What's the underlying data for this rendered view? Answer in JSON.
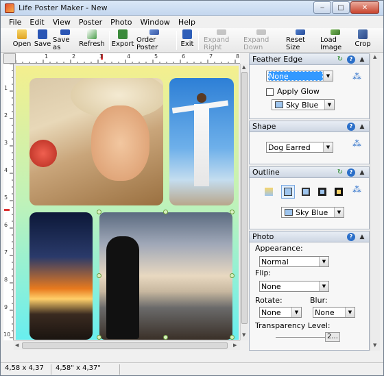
{
  "window": {
    "title": "Life Poster Maker - New"
  },
  "menu": [
    "File",
    "Edit",
    "View",
    "Poster",
    "Photo",
    "Window",
    "Help"
  ],
  "toolbar": {
    "open": "Open",
    "save": "Save",
    "save_as": "Save as",
    "refresh": "Refresh",
    "export": "Export",
    "order_poster": "Order Poster",
    "exit": "Exit",
    "expand_right": "Expand Right",
    "expand_down": "Expand Down",
    "reset_size": "Reset Size",
    "load_image": "Load Image",
    "crop": "Crop"
  },
  "ruler": {
    "h": [
      "1",
      "2",
      "3",
      "4",
      "5",
      "6",
      "7",
      "8"
    ],
    "v": [
      "1",
      "2",
      "3",
      "4",
      "5",
      "6",
      "7",
      "8",
      "9",
      "10"
    ]
  },
  "feather_edge": {
    "title": "Feather Edge",
    "mode": "None",
    "apply_glow_label": "Apply Glow",
    "color": "Sky Blue",
    "color_hex": "#9ec5ee"
  },
  "shape": {
    "title": "Shape",
    "value": "Dog Earred"
  },
  "outline": {
    "title": "Outline",
    "color": "Sky Blue",
    "color_hex": "#9ec5ee"
  },
  "photo": {
    "title": "Photo",
    "appearance_label": "Appearance:",
    "appearance": "Normal",
    "flip_label": "Flip:",
    "flip": "None",
    "rotate_label": "Rotate:",
    "rotate": "None",
    "blur_label": "Blur:",
    "blur": "None",
    "transparency_label": "Transparency Level:",
    "transparency_value": "2..."
  },
  "status": {
    "size": "4,58 x 4,37",
    "size_inches": "4,58\" x 4,37\""
  },
  "colors": {
    "accent": "#2b6fc9",
    "poster_top": "#f4ef8e",
    "poster_bottom": "#68eeef"
  }
}
